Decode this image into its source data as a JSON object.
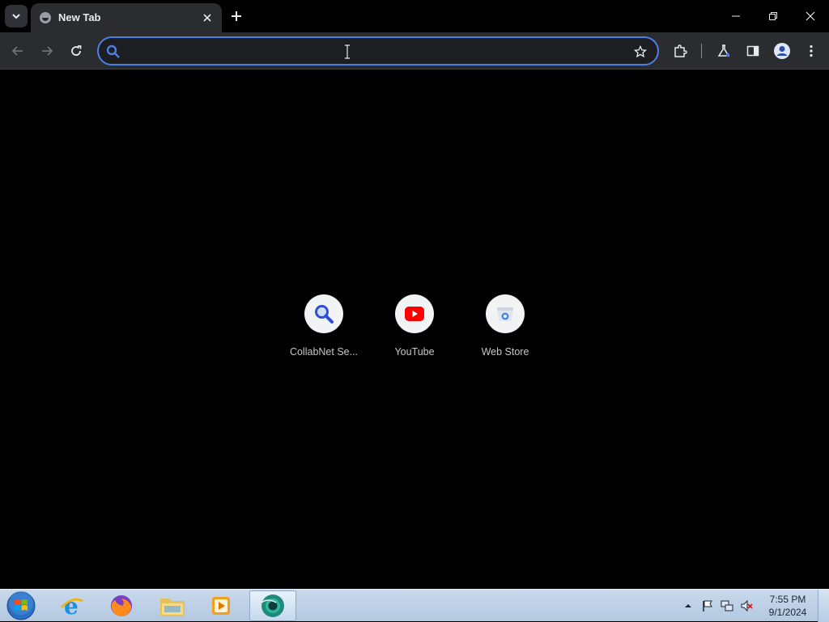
{
  "browser": {
    "tab": {
      "title": "New Tab"
    },
    "omnibox": {
      "value": "",
      "placeholder": ""
    }
  },
  "shortcuts": [
    {
      "label": "CollabNet Se...",
      "icon": "search-icon"
    },
    {
      "label": "YouTube",
      "icon": "youtube-icon"
    },
    {
      "label": "Web Store",
      "icon": "web-store-icon"
    }
  ],
  "taskbar": {
    "apps": [
      "internet-explorer-icon",
      "firefox-icon",
      "file-explorer-icon",
      "media-player-icon",
      "chrome-dev-icon"
    ],
    "clock": {
      "time": "7:55 PM",
      "date": "9/1/2024"
    }
  },
  "colors": {
    "accent": "#4c7ee6",
    "background": "#000000",
    "toolbar": "#2b2c30",
    "youtube_red": "#ff0000"
  }
}
